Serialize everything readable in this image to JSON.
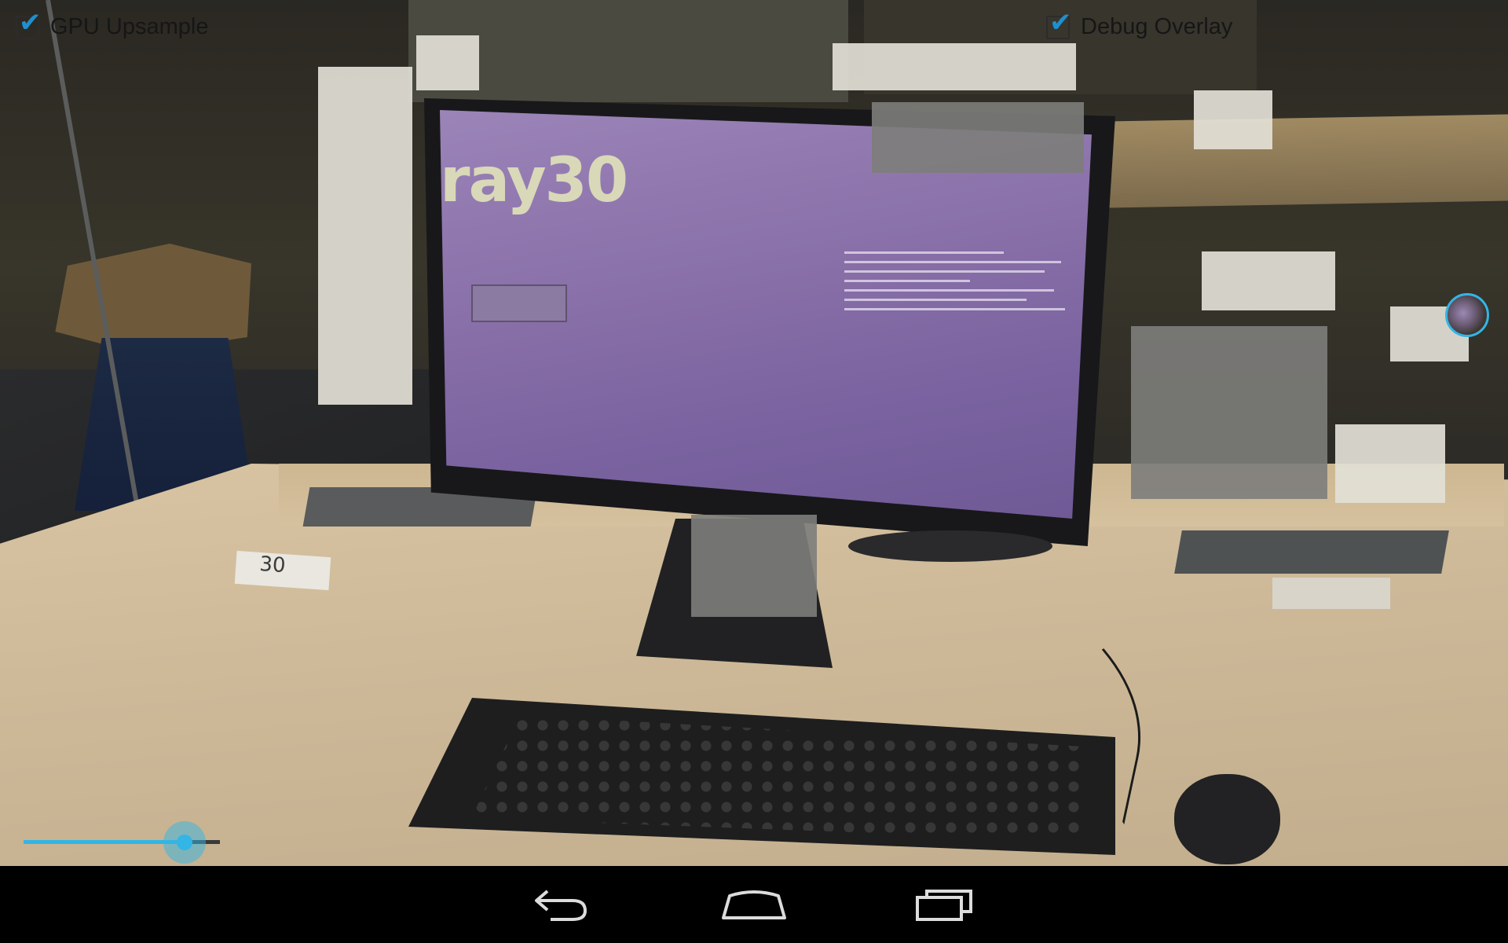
{
  "overlay": {
    "gpu_upsample": {
      "label": "GPU Upsample",
      "checked": true
    },
    "debug_overlay": {
      "label": "Debug Overlay",
      "checked": true
    },
    "slider": {
      "value": 0.82
    }
  },
  "scene": {
    "screen_title": "ray30",
    "desk_card": "30"
  },
  "navigation": {
    "buttons": [
      "back-icon",
      "home-icon",
      "recents-icon"
    ]
  },
  "colors": {
    "accent": "#33b5e5",
    "check": "#1e8fcf",
    "navbar": "#000000"
  }
}
